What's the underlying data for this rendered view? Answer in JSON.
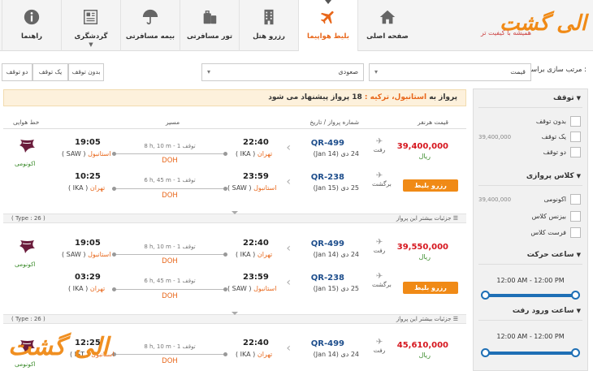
{
  "header": {
    "logo_text": "الی گشت",
    "logo_tagline": "همیشه با کیفیت تر",
    "nav": [
      {
        "label": "صفحه اصلی",
        "icon": "home-icon"
      },
      {
        "label": "بلیط هواپیما",
        "icon": "airplane-icon",
        "active": true
      },
      {
        "label": "رزرو هتل",
        "icon": "hotel-icon"
      },
      {
        "label": "تور مسافرتی",
        "icon": "luggage-icon"
      },
      {
        "label": "بیمه مسافرتی",
        "icon": "umbrella-icon"
      },
      {
        "label": "گردشگری",
        "icon": "newspaper-icon"
      },
      {
        "label": "راهنما",
        "icon": "info-icon"
      }
    ]
  },
  "sort": {
    "label": "مرتب سازی براساس :",
    "field_value": "قیمت",
    "order_value": "صعودی",
    "stop_buttons": [
      "بدون توقف",
      "یک توقف",
      "دو توقف"
    ]
  },
  "banner": {
    "prefix": "پرواز به",
    "destination": "استانبول، ترکیه :",
    "count_text": "18 پرواز پیشنهاد می شود"
  },
  "columns": {
    "price": "قیمت هرنفر",
    "flight": "شماره پرواز / تاریخ",
    "route": "مسیر",
    "airline": "خط هوایی"
  },
  "sidebar": {
    "stops_title": "توقف",
    "stops": [
      {
        "label": "بدون توقف",
        "price": ""
      },
      {
        "label": "یک توقف",
        "price": "39,400,000"
      },
      {
        "label": "دو توقف",
        "price": ""
      }
    ],
    "class_title": "کلاس پروازی",
    "classes": [
      {
        "label": "اکونومی",
        "price": "39,400,000"
      },
      {
        "label": "بیزنس کلاس",
        "price": ""
      },
      {
        "label": "فرست کلاس",
        "price": ""
      }
    ],
    "departure_title": "ساعت حرکت",
    "departure_range": "12:00 AM - 12:00 PM",
    "arrival_title": "ساعت ورود رفت",
    "arrival_range": "12:00 AM - 12:00 PM"
  },
  "results": {
    "book_label": "رزرو بلیط",
    "details_label": "جزئیات بیشتر این پرواز",
    "rial": "ریال",
    "out_label": "رفت",
    "ret_label": "برگشت",
    "airline_class": "اکونومی",
    "cards": [
      {
        "price": "39,400,000",
        "type_label": "( Type : 26 )",
        "out": {
          "flight": "QR-499",
          "date": "24 دی (14 Jan)",
          "dep_time": "22:40",
          "dep_city": "تهران",
          "dep_code": "( IKA )",
          "arr_time": "19:05",
          "arr_city": "استانبول",
          "arr_code": "( SAW )",
          "duration": "8 h, 10 m",
          "stops": "1 توقف",
          "via": "DOH"
        },
        "ret": {
          "flight": "QR-238",
          "date": "25 دی (15 Jan)",
          "dep_time": "23:59",
          "dep_city": "استانبول",
          "dep_code": "( SAW )",
          "arr_time": "10:25",
          "arr_city": "تهران",
          "arr_code": "( IKA )",
          "duration": "6 h, 45 m",
          "stops": "1 توقف",
          "via": "DOH"
        }
      },
      {
        "price": "39,550,000",
        "type_label": "( Type : 26 )",
        "out": {
          "flight": "QR-499",
          "date": "24 دی (14 Jan)",
          "dep_time": "22:40",
          "dep_city": "تهران",
          "dep_code": "( IKA )",
          "arr_time": "19:05",
          "arr_city": "استانبول",
          "arr_code": "( SAW )",
          "duration": "8 h, 10 m",
          "stops": "1 توقف",
          "via": "DOH"
        },
        "ret": {
          "flight": "QR-238",
          "date": "25 دی (15 Jan)",
          "dep_time": "23:59",
          "dep_city": "استانبول",
          "dep_code": "( SAW )",
          "arr_time": "03:29",
          "arr_city": "تهران",
          "arr_code": "( IKA )",
          "duration": "6 h, 45 m",
          "stops": "1 توقف",
          "via": "DOH"
        }
      },
      {
        "price": "45,610,000",
        "out": {
          "flight": "QR-499",
          "date": "24 دی (14 Jan)",
          "dep_time": "22:40",
          "dep_city": "تهران",
          "dep_code": "( IKA )",
          "arr_time": "12:25",
          "arr_city": "استانبول",
          "arr_code": "( IST )",
          "duration": "8 h, 10 m",
          "stops": "1 توقف",
          "via": "DOH"
        }
      }
    ]
  },
  "colors": {
    "accent": "#f08a16",
    "price": "#d6171f",
    "flight_no": "#1e4e8c",
    "slider": "#1e6fb5"
  }
}
